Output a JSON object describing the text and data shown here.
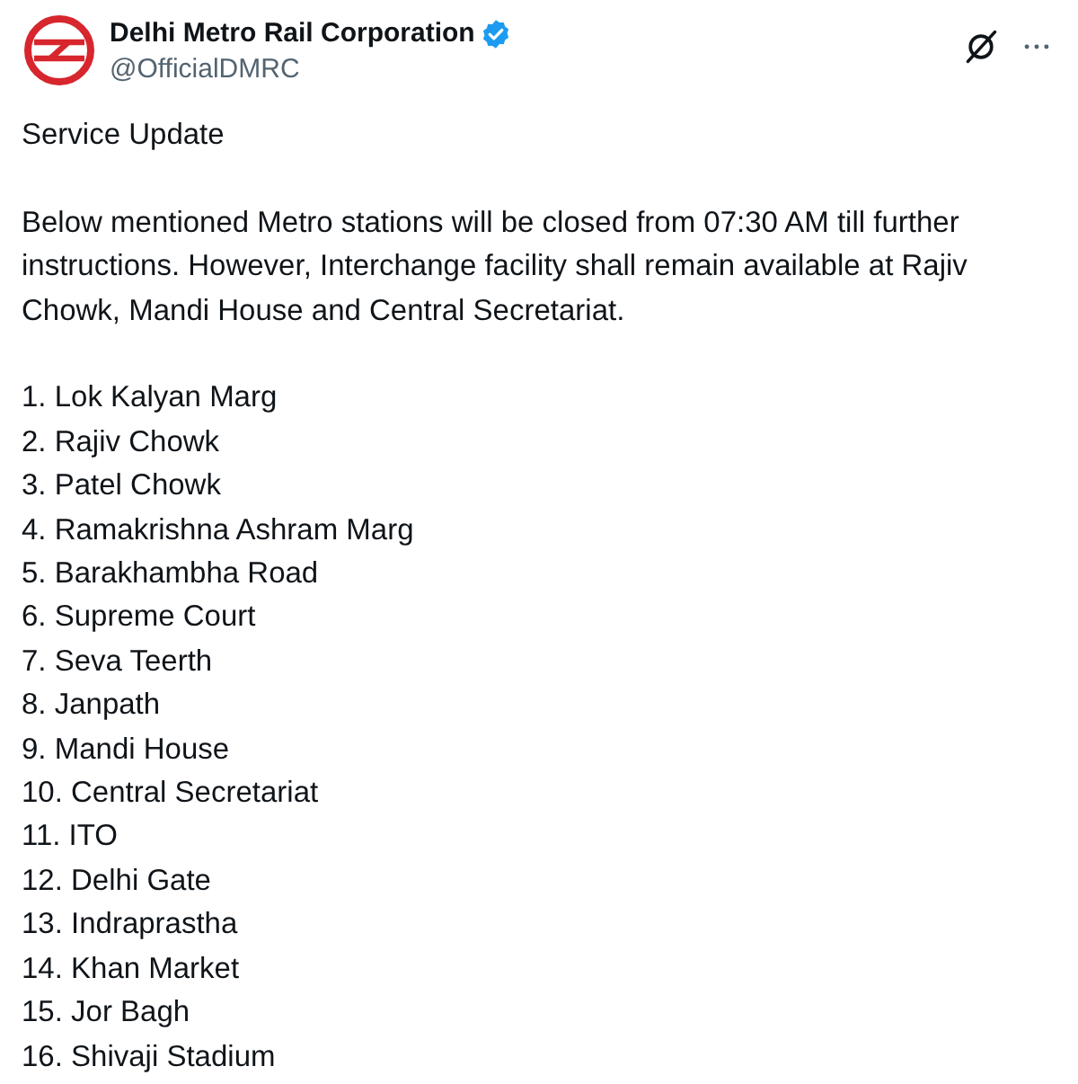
{
  "account": {
    "name": "Delhi Metro Rail Corporation",
    "verified": true,
    "handle": "@OfficialDMRC"
  },
  "post": {
    "title": "Service Update",
    "paragraph": "Below mentioned Metro stations will be closed from 07:30 AM till further instructions. However, Interchange facility shall remain available at Rajiv Chowk, Mandi House and Central Secretariat.",
    "stations": [
      "1. Lok Kalyan Marg",
      "2. Rajiv Chowk",
      "3. Patel Chowk",
      "4. Ramakrishna Ashram Marg",
      "5. Barakhambha Road",
      "6. Supreme Court",
      "7. Seva Teerth",
      "8. Janpath",
      "9. Mandi House",
      "10. Central Secretariat",
      "11. ITO",
      "12. Delhi Gate",
      "13. Indraprastha",
      "14. Khan Market",
      "15. Jor Bagh",
      "16. Shivaji Stadium"
    ]
  }
}
